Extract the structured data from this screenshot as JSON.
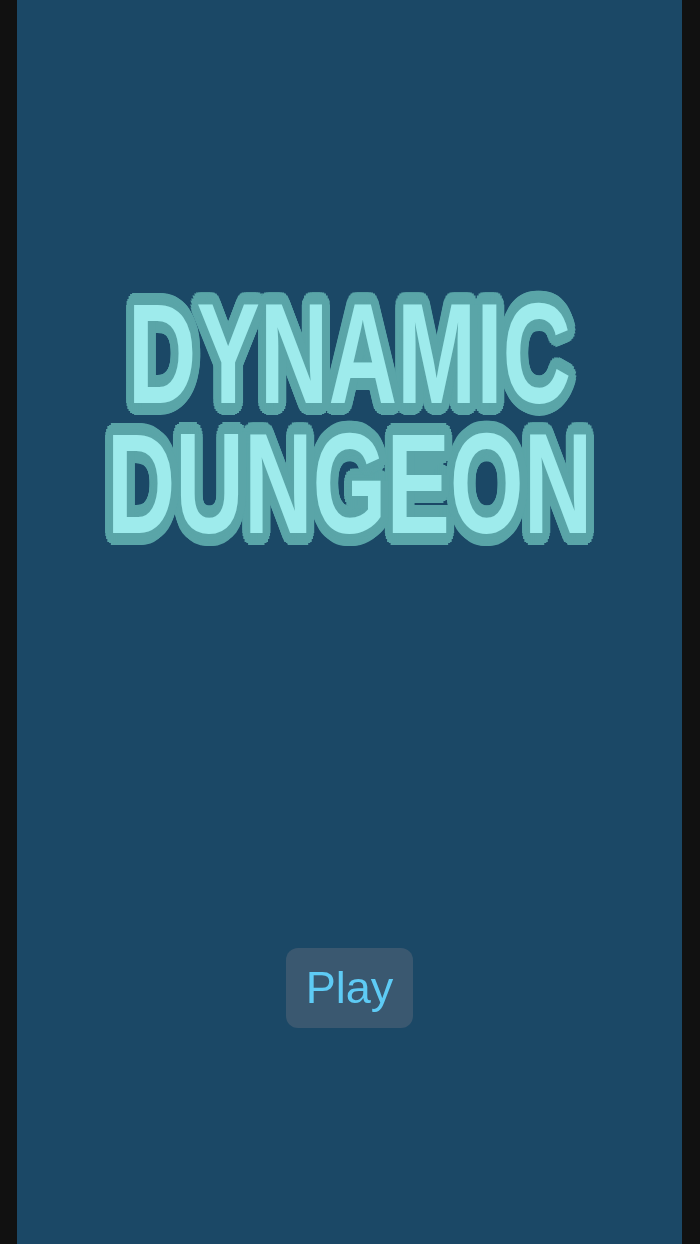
{
  "title": "DYNAMIC DUNGEON",
  "play_button": {
    "label": "Play"
  }
}
